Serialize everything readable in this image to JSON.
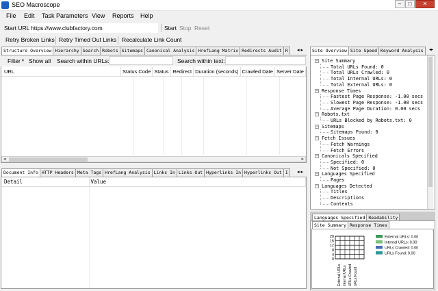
{
  "app": {
    "title": "SEO Macroscope"
  },
  "menu": [
    "File",
    "Edit",
    "Task Parameters",
    "View",
    "Reports",
    "Help"
  ],
  "url_bar": {
    "label": "Start URL:",
    "value": "https://www.clubfactory.com",
    "start": "Start",
    "stop": "Stop",
    "reset": "Reset"
  },
  "actions": [
    "Retry Broken Links",
    "Retry Timed Out Links",
    "Recalculate Link Count"
  ],
  "top_tabs": [
    "Structure Overview",
    "Hierarchy",
    "Search",
    "Robots",
    "Sitemaps",
    "Canonical Analysis",
    "HrefLang Matrix",
    "Redirects Audit",
    "R"
  ],
  "filter": {
    "label": "Filter",
    "show_all": "Show all",
    "search_urls": "Search within URLs:",
    "search_text": "Search within text:"
  },
  "structure_columns": [
    "URL",
    "Status Code",
    "Status",
    "Redirect",
    "Duration (seconds)",
    "Crawled Date",
    "Server Date"
  ],
  "bottom_tabs": [
    "Document Info",
    "HTTP Headers",
    "Meta Tags",
    "HrefLang Analysis",
    "Links In",
    "Links Out",
    "Hyperlinks In",
    "Hyperlinks Out",
    "I"
  ],
  "detail_columns": [
    "Detail",
    "Value"
  ],
  "right_tabs": [
    "Site Overview",
    "Site Speed",
    "Keyword Analysis"
  ],
  "overview_tree": [
    {
      "label": "Site Summary",
      "children": [
        "Total URLs Found: 0",
        "Total URLs Crawled: 0",
        "Total Internal URLs: 0",
        "Total External URLs: 0"
      ]
    },
    {
      "label": "Response Times",
      "children": [
        "Fastest Page Response: -1.00 secs",
        "Slowest Page Response: -1.00 secs",
        "Average Page Duration: 0.00 secs"
      ]
    },
    {
      "label": "Robots.txt",
      "children": [
        "URLs Blocked by Robots.txt: 0"
      ]
    },
    {
      "label": "Sitemaps",
      "children": [
        "Sitemaps Found: 0"
      ]
    },
    {
      "label": "Fetch Issues",
      "children": [
        "Fetch Warnings",
        "Fetch Errors"
      ]
    },
    {
      "label": "Canonicals Specified",
      "children": [
        "Specified: 0",
        "Not Specified: 0"
      ]
    },
    {
      "label": "Languages Specified",
      "children": [
        "Pages"
      ]
    },
    {
      "label": "Languages Detected",
      "children": [
        "Titles",
        "Descriptions",
        "Contents"
      ]
    }
  ],
  "lower_right_tabs_a": [
    "Languages Specified",
    "Readability"
  ],
  "lower_right_tabs_b": [
    "Site Summary",
    "Response Times"
  ],
  "summary_chart": {
    "y_ticks": [
      "20",
      "16",
      "12",
      "8",
      "4",
      "0"
    ],
    "categories": [
      "External URLs",
      "Internal URLs",
      "URLs Crawled",
      "URLs Found"
    ],
    "legend": [
      {
        "label": "External URLs: 0.00",
        "color": "#3a9a5a"
      },
      {
        "label": "Internal URLs: 0.00",
        "color": "#7bc07b"
      },
      {
        "label": "URLs Crawled: 0.00",
        "color": "#4a6fb0"
      },
      {
        "label": "URLs Found: 0.00",
        "color": "#2f9a9a"
      }
    ]
  },
  "chart_data": {
    "type": "bar",
    "categories": [
      "External URLs",
      "Internal URLs",
      "URLs Crawled",
      "URLs Found"
    ],
    "values": [
      0,
      0,
      0,
      0
    ],
    "ylim": [
      0,
      20
    ]
  }
}
